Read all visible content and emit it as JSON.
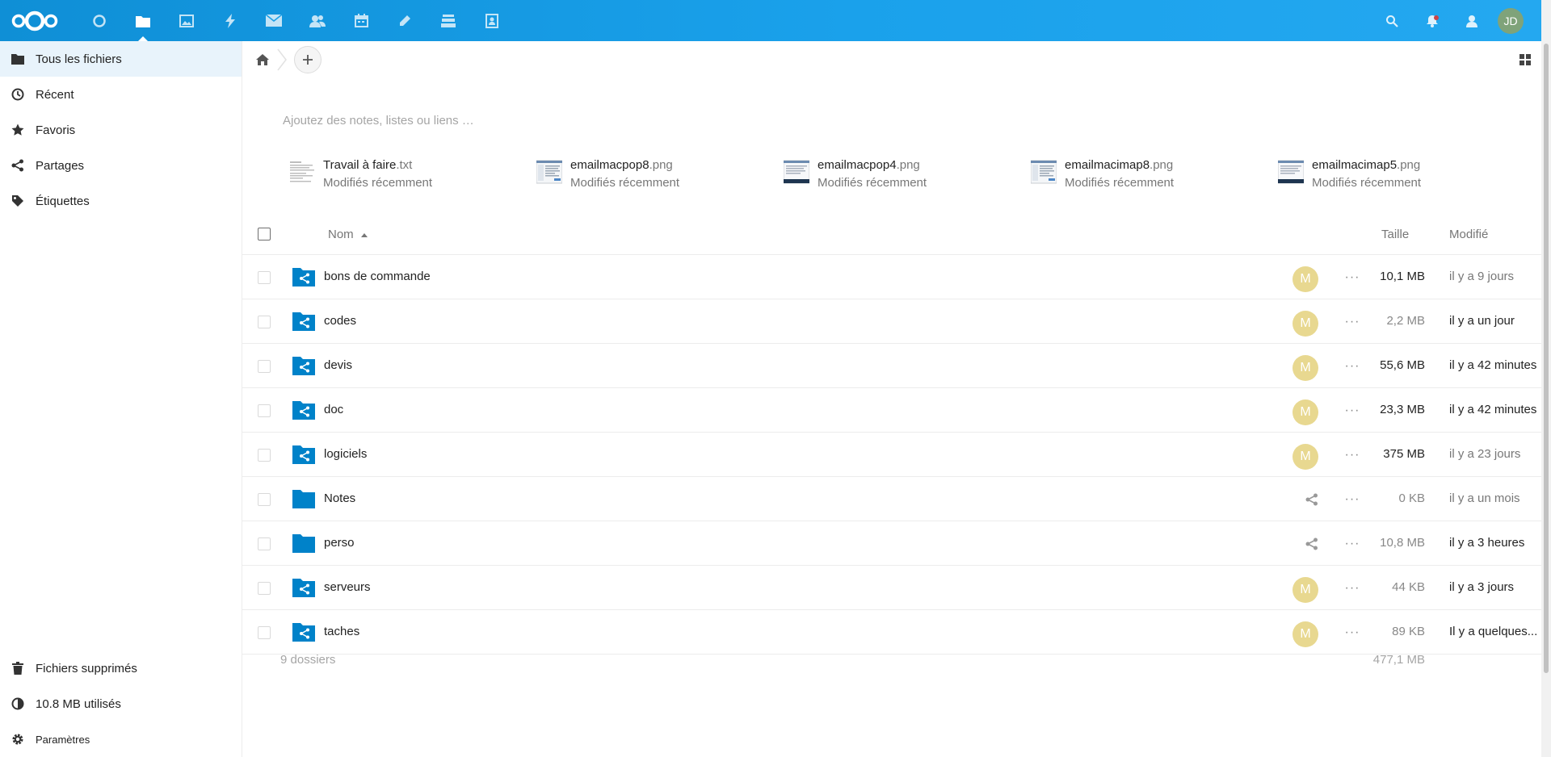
{
  "header": {
    "apps": [
      "dashboard",
      "files",
      "photos",
      "activity",
      "mail",
      "contacts",
      "calendar",
      "notes",
      "deck",
      "contacts-book"
    ],
    "active_app": "files",
    "user_initials": "JD"
  },
  "sidebar": {
    "items": [
      {
        "label": "Tous les fichiers",
        "icon": "folder-icon",
        "active": true
      },
      {
        "label": "Récent",
        "icon": "clock-icon"
      },
      {
        "label": "Favoris",
        "icon": "star-icon"
      },
      {
        "label": "Partages",
        "icon": "share-icon"
      },
      {
        "label": "Étiquettes",
        "icon": "tag-icon"
      }
    ],
    "bottom": {
      "deleted": "Fichiers supprimés",
      "quota": "10.8 MB utilisés",
      "settings": "Paramètres"
    }
  },
  "main": {
    "notes_placeholder": "Ajoutez des notes, listes ou liens …",
    "recent": [
      {
        "base": "Travail à faire",
        "ext": ".txt",
        "sub": "Modifiés récemment"
      },
      {
        "base": "emailmacpop8",
        "ext": ".png",
        "sub": "Modifiés récemment"
      },
      {
        "base": "emailmacpop4",
        "ext": ".png",
        "sub": "Modifiés récemment"
      },
      {
        "base": "emailmacimap8",
        "ext": ".png",
        "sub": "Modifiés récemment"
      },
      {
        "base": "emailmacimap5",
        "ext": ".png",
        "sub": "Modifiés récemment"
      }
    ],
    "columns": {
      "name": "Nom",
      "size": "Taille",
      "modified": "Modifié"
    },
    "files": [
      {
        "name": "bons de commande",
        "shared": true,
        "avatar": "M",
        "size": "10,1 MB",
        "modified": "il y a 9 jours"
      },
      {
        "name": "codes",
        "shared": true,
        "avatar": "M",
        "size": "2,2 MB",
        "modified": "il y a un jour"
      },
      {
        "name": "devis",
        "shared": true,
        "avatar": "M",
        "size": "55,6 MB",
        "modified": "il y a 42 minutes"
      },
      {
        "name": "doc",
        "shared": true,
        "avatar": "M",
        "size": "23,3 MB",
        "modified": "il y a 42 minutes"
      },
      {
        "name": "logiciels",
        "shared": true,
        "avatar": "M",
        "size": "375 MB",
        "modified": "il y a 23 jours"
      },
      {
        "name": "Notes",
        "shared": false,
        "avatar": "",
        "size": "0 KB",
        "modified": "il y a un mois"
      },
      {
        "name": "perso",
        "shared": false,
        "avatar": "",
        "size": "10,8 MB",
        "modified": "il y a 3 heures"
      },
      {
        "name": "serveurs",
        "shared": true,
        "avatar": "M",
        "size": "44 KB",
        "modified": "il y a 3 jours"
      },
      {
        "name": "taches",
        "shared": true,
        "avatar": "M",
        "size": "89 KB",
        "modified": "Il y a quelques..."
      }
    ],
    "summary": {
      "count": "9 dossiers",
      "total": "477,1 MB"
    }
  },
  "colors": {
    "header": "#1aa1eb",
    "folder": "#0082c9",
    "avatar": "#e8d890",
    "active_nav": "#e8f3fb"
  }
}
